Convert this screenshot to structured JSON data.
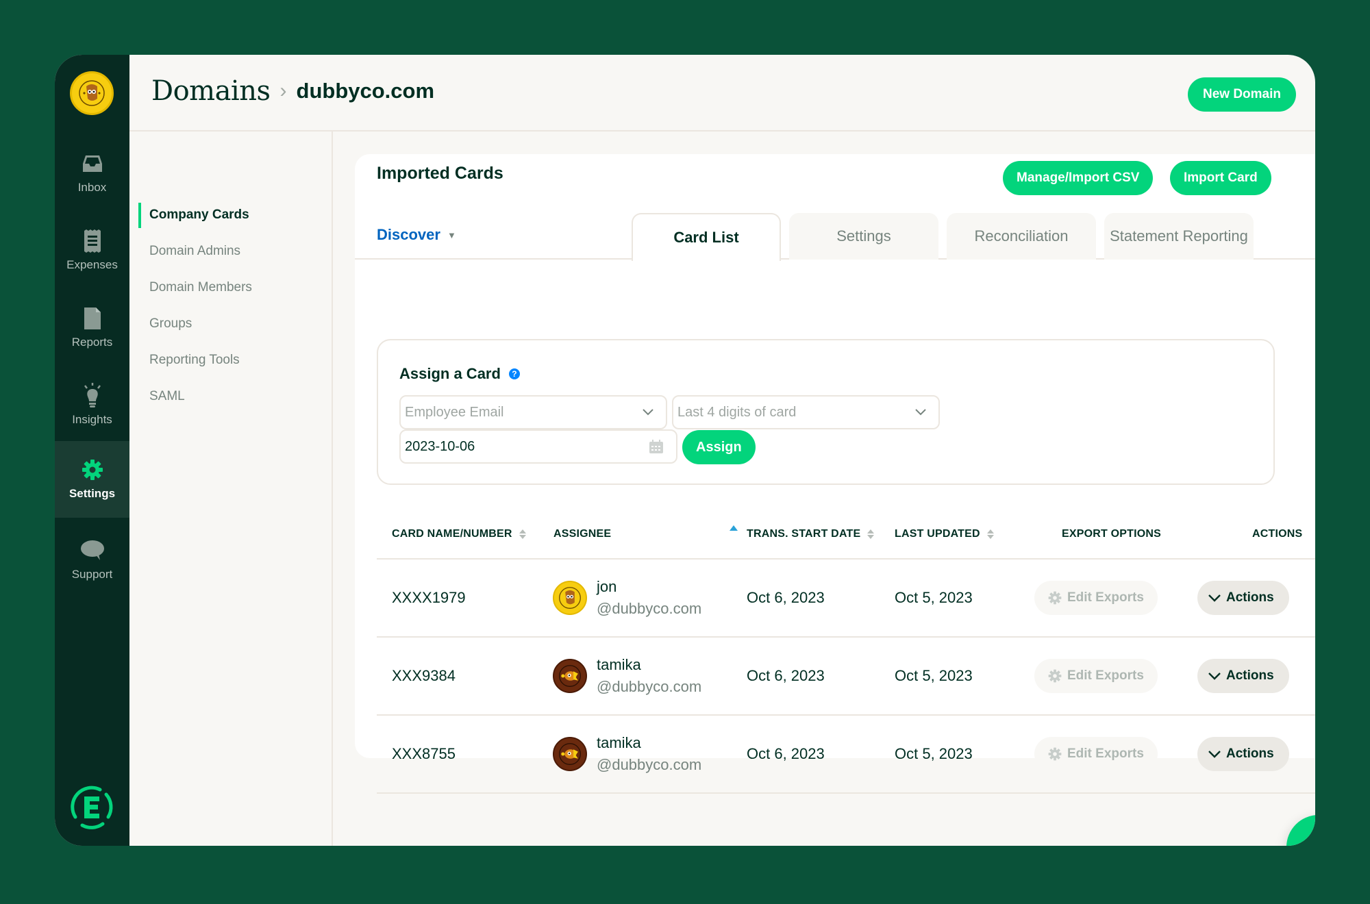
{
  "colors": {
    "background": "#0a5239",
    "nav_bg": "#072b22",
    "accent": "#03d47c",
    "text": "#002e22",
    "link_blue": "#0164bf"
  },
  "leftnav": {
    "items": [
      {
        "label": "Inbox",
        "icon": "inbox-icon",
        "active": false
      },
      {
        "label": "Expenses",
        "icon": "receipt-icon",
        "active": false
      },
      {
        "label": "Reports",
        "icon": "document-icon",
        "active": false
      },
      {
        "label": "Insights",
        "icon": "lightbulb-icon",
        "active": false
      },
      {
        "label": "Settings",
        "icon": "gear-icon",
        "active": true
      },
      {
        "label": "Support",
        "icon": "chat-bubble-icon",
        "active": false
      }
    ]
  },
  "header": {
    "breadcrumb_root": "Domains",
    "breadcrumb_sep": "›",
    "breadcrumb_current": "dubbyco.com",
    "new_domain_label": "New Domain"
  },
  "subnav": {
    "items": [
      {
        "label": "Company Cards",
        "active": true
      },
      {
        "label": "Domain Admins",
        "active": false
      },
      {
        "label": "Domain Members",
        "active": false
      },
      {
        "label": "Groups",
        "active": false
      },
      {
        "label": "Reporting Tools",
        "active": false
      },
      {
        "label": "SAML",
        "active": false
      }
    ]
  },
  "card": {
    "title": "Imported Cards",
    "manage_csv_label": "Manage/Import CSV",
    "import_card_label": "Import Card",
    "feed_selector": "Discover",
    "tabs": [
      {
        "label": "Card List",
        "active": true
      },
      {
        "label": "Settings",
        "active": false
      },
      {
        "label": "Reconciliation",
        "active": false
      },
      {
        "label": "Statement Reporting",
        "active": false
      }
    ]
  },
  "assign": {
    "title": "Assign a Card",
    "employee_placeholder": "Employee Email",
    "last4_placeholder": "Last 4 digits of card",
    "date_value": "2023-10-06",
    "assign_label": "Assign"
  },
  "table": {
    "columns": [
      {
        "label": "CARD NAME/NUMBER",
        "sortable": true
      },
      {
        "label": "ASSIGNEE",
        "sortable": true,
        "sorted": "asc"
      },
      {
        "label": "TRANS. START DATE",
        "sortable": true
      },
      {
        "label": "LAST UPDATED",
        "sortable": true
      },
      {
        "label": "EXPORT OPTIONS",
        "sortable": false
      },
      {
        "label": "ACTIONS",
        "sortable": false
      }
    ],
    "rows": [
      {
        "card": "XXXX1979",
        "assignee_name": "jon",
        "assignee_email": "@dubbyco.com",
        "avatar": "yellow",
        "start_date": "Oct 6, 2023",
        "last_updated": "Oct 5, 2023",
        "export_label": "Edit Exports",
        "actions_label": "Actions"
      },
      {
        "card": "XXX9384",
        "assignee_name": "tamika",
        "assignee_email": "@dubbyco.com",
        "avatar": "brown",
        "start_date": "Oct 6, 2023",
        "last_updated": "Oct 5, 2023",
        "export_label": "Edit Exports",
        "actions_label": "Actions"
      },
      {
        "card": "XXX8755",
        "assignee_name": "tamika",
        "assignee_email": "@dubbyco.com",
        "avatar": "brown",
        "start_date": "Oct 6, 2023",
        "last_updated": "Oct 5, 2023",
        "export_label": "Edit Exports",
        "actions_label": "Actions"
      }
    ]
  }
}
